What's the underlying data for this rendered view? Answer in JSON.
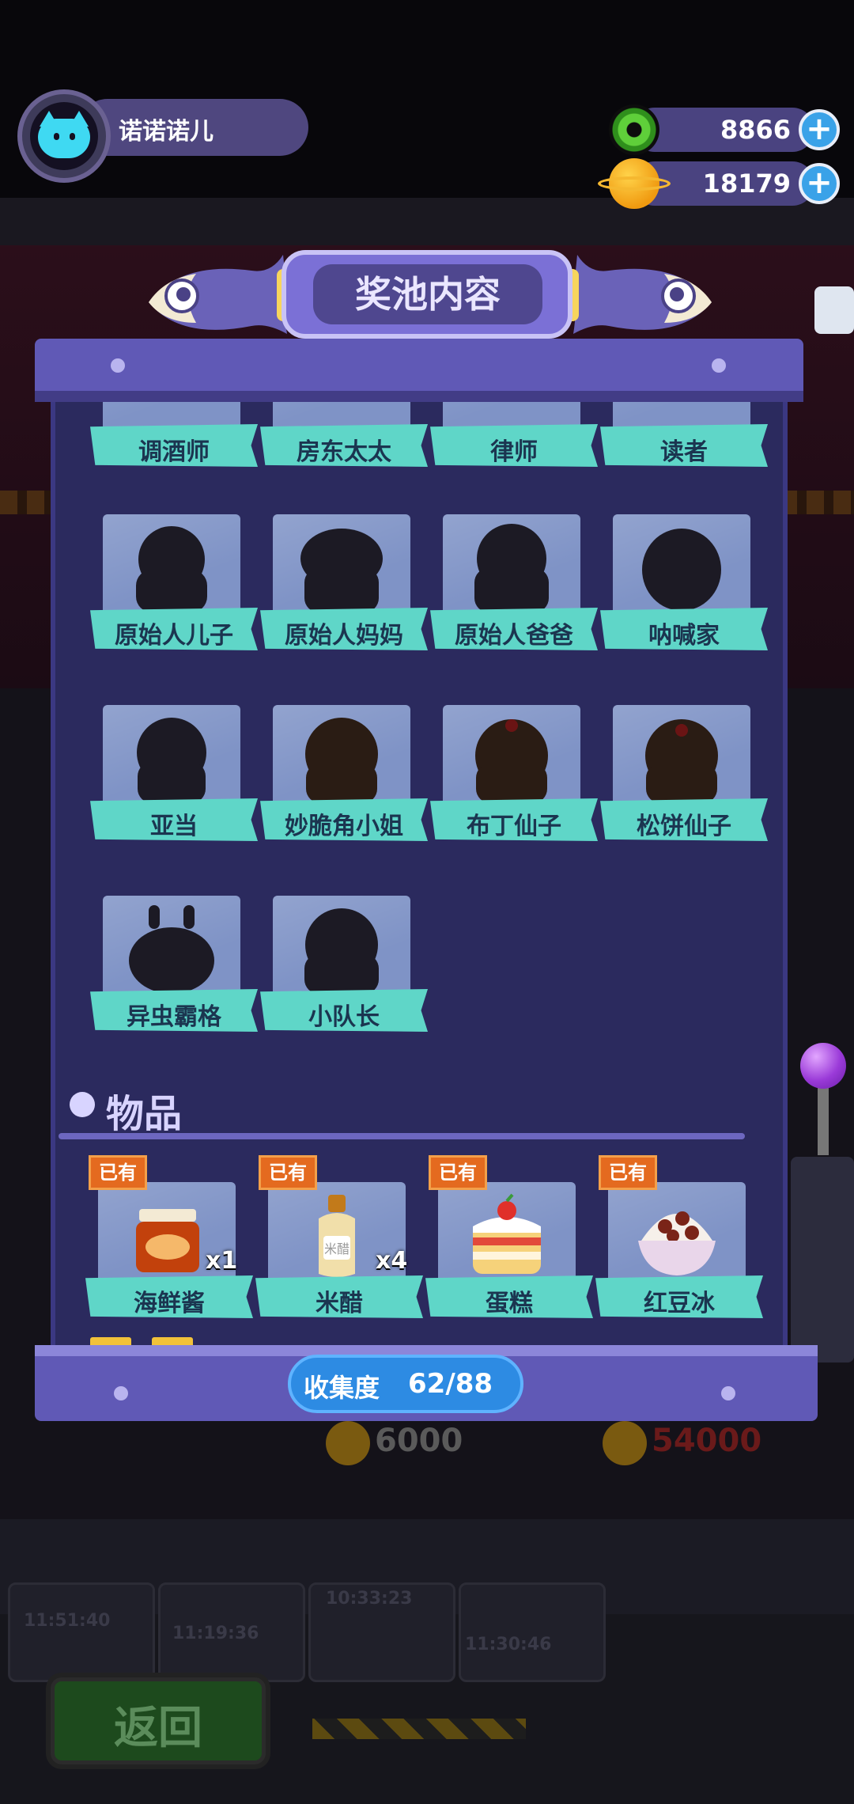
{
  "hud": {
    "player_name": "诺诺诺儿",
    "currency_donut": "8866",
    "currency_planet": "18179",
    "add_symbol": "+"
  },
  "panel": {
    "title": "奖池内容",
    "characters": [
      {
        "name": "调酒师"
      },
      {
        "name": "房东太太"
      },
      {
        "name": "律师"
      },
      {
        "name": "读者"
      },
      {
        "name": "原始人儿子"
      },
      {
        "name": "原始人妈妈"
      },
      {
        "name": "原始人爸爸"
      },
      {
        "name": "呐喊家"
      },
      {
        "name": "亚当"
      },
      {
        "name": "妙脆角小姐"
      },
      {
        "name": "布丁仙子"
      },
      {
        "name": "松饼仙子"
      },
      {
        "name": "异虫霸格"
      },
      {
        "name": "小队长"
      }
    ],
    "items_section_title": "物品",
    "items": [
      {
        "name": "海鲜酱",
        "owned": "已有",
        "qty": "x1",
        "icon": "sauce-jar-icon"
      },
      {
        "name": "米醋",
        "owned": "已有",
        "qty": "x4",
        "icon": "vinegar-bottle-icon"
      },
      {
        "name": "蛋糕",
        "owned": "已有",
        "qty": "",
        "icon": "cake-icon"
      },
      {
        "name": "红豆冰",
        "owned": "已有",
        "qty": "",
        "icon": "red-bean-ice-icon"
      }
    ],
    "collection_label": "收集度",
    "collection_value": "62/88",
    "collection_progress": 0.7045
  },
  "background": {
    "back_button": "返回",
    "price_left": "6000",
    "price_right": "54000",
    "bg_collection_text": "收集度  62/88",
    "timers": [
      "11:51:40",
      "11:19:36",
      "10:33:23",
      "11:30:46"
    ]
  },
  "colors": {
    "panel_purple": "#6059b6",
    "panel_inner": "#2b2a5e",
    "label_teal": "#5fd6c8",
    "owned_orange": "#e46a1f",
    "progress_blue": "#2d8be3"
  }
}
